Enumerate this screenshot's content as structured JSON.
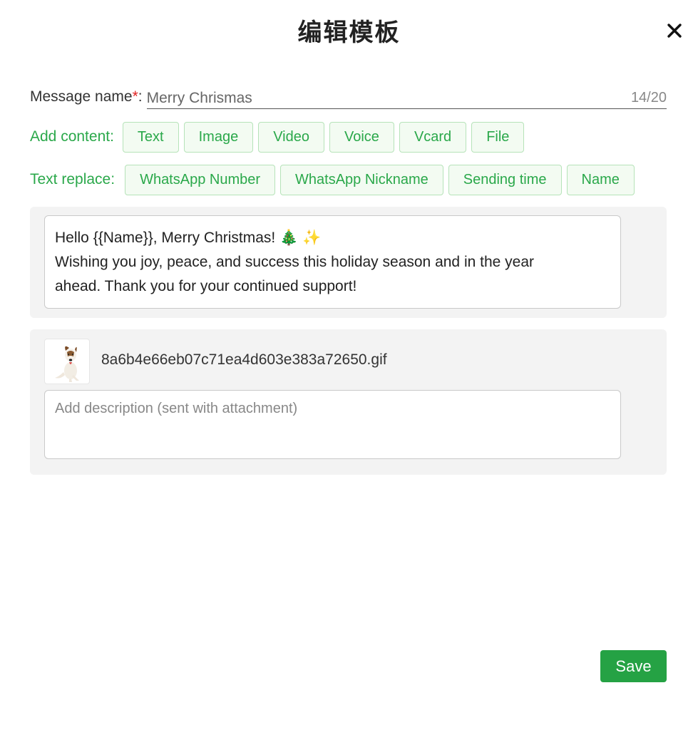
{
  "dialog": {
    "title": "编辑模板"
  },
  "form": {
    "name_label": "Message name",
    "required_mark": "*",
    "name_colon": ":",
    "name_value": "Merry Chrismas",
    "name_counter": "14/20",
    "add_content_label": "Add content:",
    "add_content_buttons": [
      "Text",
      "Image",
      "Video",
      "Voice",
      "Vcard",
      "File"
    ],
    "text_replace_label": "Text replace:",
    "text_replace_buttons": [
      "WhatsApp Number",
      "WhatsApp Nickname",
      "Sending time",
      "Name"
    ]
  },
  "text_block": {
    "line1": "Hello {{Name}}, Merry Christmas! 🎄 ✨",
    "line2": "Wishing you joy, peace, and success this holiday season and in the year",
    "line3": "ahead. Thank you for your continued support!"
  },
  "attachment": {
    "file_name": "8a6b4e66eb07c71ea4d603e383a72650.gif",
    "description_placeholder": "Add description (sent with attachment)"
  },
  "actions": {
    "save_label": "Save"
  },
  "colors": {
    "accent_green": "#2aa84a",
    "save_green": "#25a244",
    "required_red": "#e02020"
  }
}
